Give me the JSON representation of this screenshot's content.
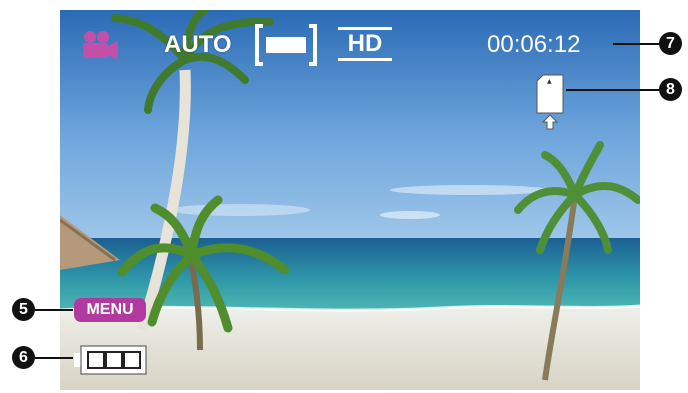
{
  "osd": {
    "mode_icon": "video-camera-icon",
    "scene_mode": "AUTO",
    "quality": "HD",
    "recording_time": "00:06:12",
    "storage_icon": "sd-card-icon",
    "menu_label": "MENU",
    "battery_icon": "battery-icon",
    "battery_level": 1.0
  },
  "callouts": [
    "5",
    "6",
    "7",
    "8"
  ],
  "colors": {
    "menu_bg": "#b13aa0",
    "mode_icon": "#c44fa9",
    "osd_text": "#ffffff",
    "callout_bg": "#111111"
  }
}
